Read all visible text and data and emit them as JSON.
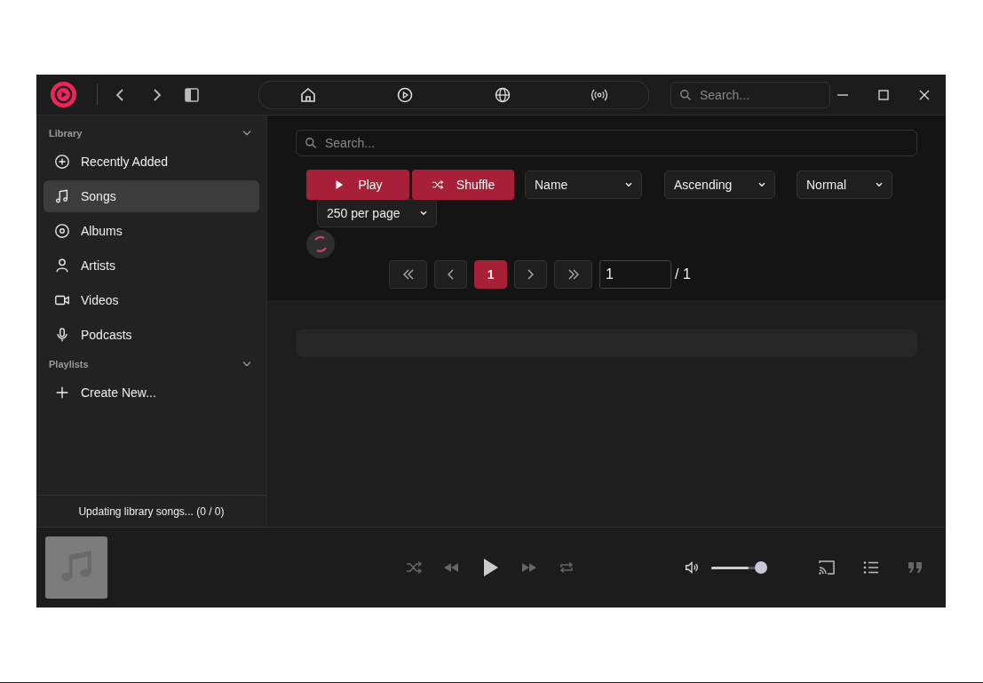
{
  "titlebar": {
    "tabs": [
      {
        "kind": "home",
        "selected": false
      },
      {
        "kind": "play",
        "selected": false
      },
      {
        "kind": "globe",
        "selected": false
      },
      {
        "kind": "radio",
        "selected": false
      }
    ],
    "search": {
      "placeholder": "Search..."
    }
  },
  "sidebar": {
    "sections": [
      {
        "title": "Library",
        "expanded": true,
        "items": [
          {
            "label": "Recently Added",
            "kind": "plus-circle",
            "selected": false
          },
          {
            "label": "Songs",
            "kind": "note",
            "selected": true
          },
          {
            "label": "Albums",
            "kind": "disc",
            "selected": false
          },
          {
            "label": "Artists",
            "kind": "person",
            "selected": false
          },
          {
            "label": "Videos",
            "kind": "video",
            "selected": false
          },
          {
            "label": "Podcasts",
            "kind": "mic",
            "selected": false
          }
        ]
      },
      {
        "title": "Playlists",
        "expanded": true,
        "items": [
          {
            "label": "Create New...",
            "kind": "plus",
            "selected": false
          }
        ]
      }
    ],
    "status": "Updating library songs... (0 / 0)"
  },
  "main": {
    "search": {
      "placeholder": "Search..."
    },
    "play_button": "Play",
    "shuffle_button": "Shuffle",
    "selects": [
      "Name",
      "Ascending",
      "Normal"
    ],
    "per_page": "250 per page",
    "pagination": {
      "pages": [
        {
          "label": "1",
          "selected": true
        }
      ],
      "page_input": "1",
      "total": "/ 1"
    }
  },
  "player": {
    "volume": {
      "level": 1
    }
  }
}
